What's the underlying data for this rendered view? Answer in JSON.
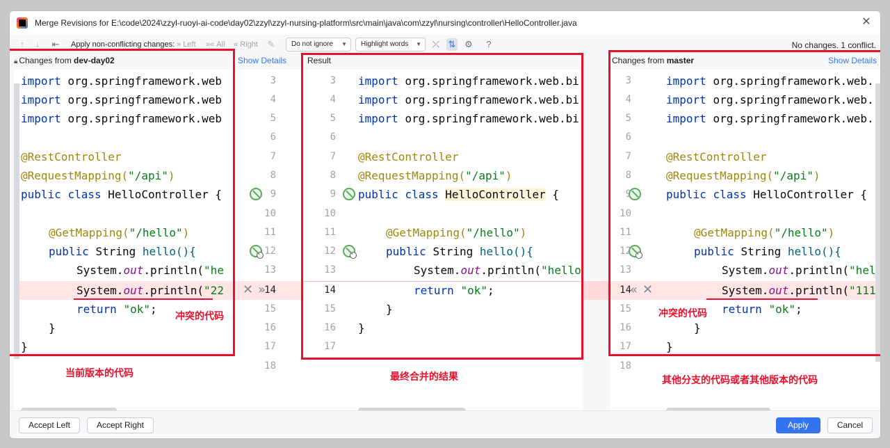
{
  "window": {
    "title": "Merge Revisions for E:\\code\\2024\\zzyl-ruoyi-ai-code\\day02\\zzyl\\zzyl-nursing-platform\\src\\main\\java\\com\\zzyl\\nursing\\controller\\HelloController.java"
  },
  "toolbar": {
    "apply_non_conflicting": "Apply non-conflicting changes:",
    "left": "Left",
    "all": "All",
    "right": "Right",
    "ignore_combo": "Do not ignore",
    "highlight_combo": "Highlight words",
    "status": "No changes. 1 conflict."
  },
  "left_panel": {
    "header_prefix": "Changes from ",
    "branch": "dev-day02",
    "show_details": "Show Details"
  },
  "center_panel": {
    "header": "Result"
  },
  "right_panel": {
    "header_prefix": "Changes from ",
    "branch": "master",
    "show_details": "Show Details"
  },
  "line_numbers": [
    "3",
    "4",
    "5",
    "6",
    "7",
    "8",
    "9",
    "10",
    "11",
    "12",
    "13",
    "14",
    "15",
    "16",
    "17",
    "18"
  ],
  "left_code": {
    "l3": "org.springframework.web",
    "l4": "org.springframework.web",
    "l5": "org.springframework.web",
    "l7": "@RestController",
    "l8_a": "@RequestMapping(",
    "l8_s": "\"/api\"",
    "l8_b": ")",
    "l9_cls": "HelloController {",
    "l11_a": "@GetMapping(",
    "l11_s": "\"/hello\"",
    "l11_b": ")",
    "l12_type": "String ",
    "l12_m": "hello(){",
    "l13_a": "System.",
    "l13_out": "out",
    "l13_b": ".println(",
    "l13_s": "\"he",
    "l14_a": "System.",
    "l14_out": "out",
    "l14_b": ".println(",
    "l14_s": "\"22",
    "l15_s": "\"ok\"",
    "l15_b": ";",
    "l16": "}",
    "l17": "}"
  },
  "center_code": {
    "l3": "org.springframework.web.bi",
    "l4": "org.springframework.web.bi",
    "l5": "org.springframework.web.bi",
    "l7": "@RestController",
    "l8_a": "@RequestMapping(",
    "l8_s": "\"/api\"",
    "l8_b": ")",
    "l9_cls": "HelloController",
    "l9_b": " {",
    "l11_a": "@GetMapping(",
    "l11_s": "\"/hello\"",
    "l11_b": ")",
    "l12_type": "String ",
    "l12_m": "hello(){",
    "l13_a": "System.",
    "l13_out": "out",
    "l13_b": ".println(",
    "l13_s": "\"hello",
    "l14_s": "\"ok\"",
    "l14_b": ";",
    "l15": "}",
    "l16": "}"
  },
  "right_code": {
    "l3": "org.springframework.web.",
    "l4": "org.springframework.web.",
    "l5": "org.springframework.web.",
    "l7": "@RestController",
    "l8_a": "@RequestMapping(",
    "l8_s": "\"/api\"",
    "l8_b": ")",
    "l9_cls": "HelloController {",
    "l11_a": "@GetMapping(",
    "l11_s": "\"/hello\"",
    "l11_b": ")",
    "l12_type": "String ",
    "l12_m": "hello(){",
    "l13_a": "System.",
    "l13_out": "out",
    "l13_b": ".println(",
    "l13_s": "\"hell",
    "l14_a": "System.",
    "l14_out": "out",
    "l14_b": ".println(",
    "l14_s": "\"111",
    "l15_s": "\"ok\"",
    "l15_b": ";",
    "l16": "}",
    "l17": "}"
  },
  "keywords": {
    "import": "import",
    "public": "public",
    "class": "class",
    "return": "return"
  },
  "annotations": {
    "conflict_left": "冲突的代码",
    "conflict_right": "冲突的代码",
    "current_version": "当前版本的代码",
    "final_result": "最终合并的结果",
    "other_branch": "其他分支的代码或者其他版本的代码"
  },
  "footer": {
    "accept_left": "Accept Left",
    "accept_right": "Accept Right",
    "apply": "Apply",
    "cancel": "Cancel"
  },
  "colors": {
    "accent": "#3574f0",
    "annotation_red": "#e8112d",
    "conflict_bg": "#ffe5e5"
  }
}
